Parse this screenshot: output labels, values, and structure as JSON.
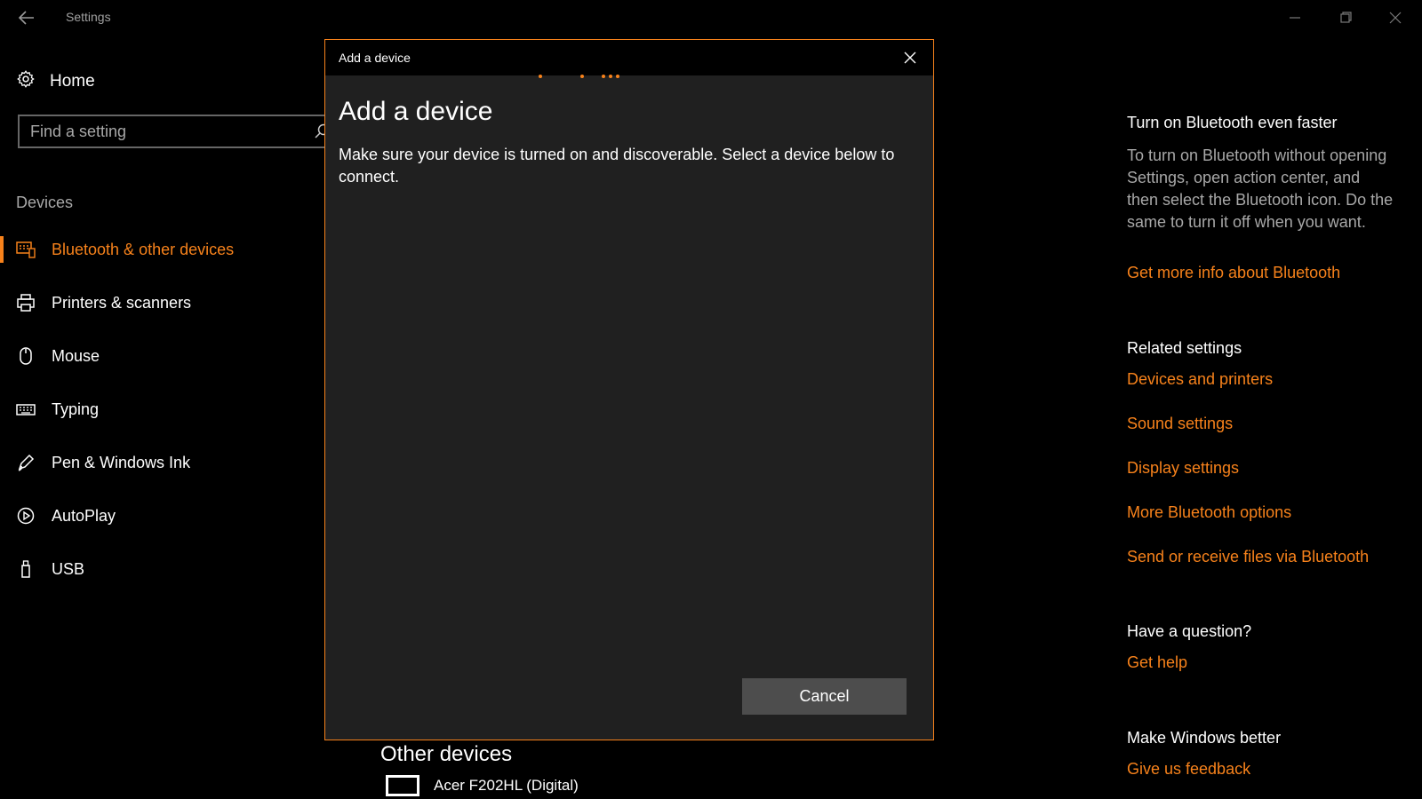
{
  "window": {
    "title": "Settings"
  },
  "nav": {
    "home_label": "Home",
    "search_placeholder": "Find a setting",
    "section_label": "Devices",
    "items": [
      {
        "label": "Bluetooth & other devices",
        "icon": "bluetooth-devices-icon",
        "active": true
      },
      {
        "label": "Printers & scanners",
        "icon": "printer-icon",
        "active": false
      },
      {
        "label": "Mouse",
        "icon": "mouse-icon",
        "active": false
      },
      {
        "label": "Typing",
        "icon": "keyboard-icon",
        "active": false
      },
      {
        "label": "Pen & Windows Ink",
        "icon": "pen-icon",
        "active": false
      },
      {
        "label": "AutoPlay",
        "icon": "autoplay-icon",
        "active": false
      },
      {
        "label": "USB",
        "icon": "usb-icon",
        "active": false
      }
    ]
  },
  "main": {
    "other_devices_heading": "Other devices",
    "device_name": "Acer F202HL (Digital)"
  },
  "right": {
    "tip_heading": "Turn on Bluetooth even faster",
    "tip_text": "To turn on Bluetooth without opening Settings, open action center, and then select the Bluetooth icon. Do the same to turn it off when you want.",
    "tip_link": "Get more info about Bluetooth",
    "related_heading": "Related settings",
    "related_links": [
      "Devices and printers",
      "Sound settings",
      "Display settings",
      "More Bluetooth options",
      "Send or receive files via Bluetooth"
    ],
    "question_heading": "Have a question?",
    "help_link": "Get help",
    "feedback_heading": "Make Windows better",
    "feedback_link": "Give us feedback"
  },
  "dialog": {
    "title": "Add a device",
    "heading": "Add a device",
    "description": "Make sure your device is turned on and discoverable. Select a device below to connect.",
    "cancel_label": "Cancel"
  },
  "colors": {
    "accent": "#f7821b",
    "background": "#000000",
    "dialog_background": "#202020",
    "button": "#4d4d4d"
  }
}
